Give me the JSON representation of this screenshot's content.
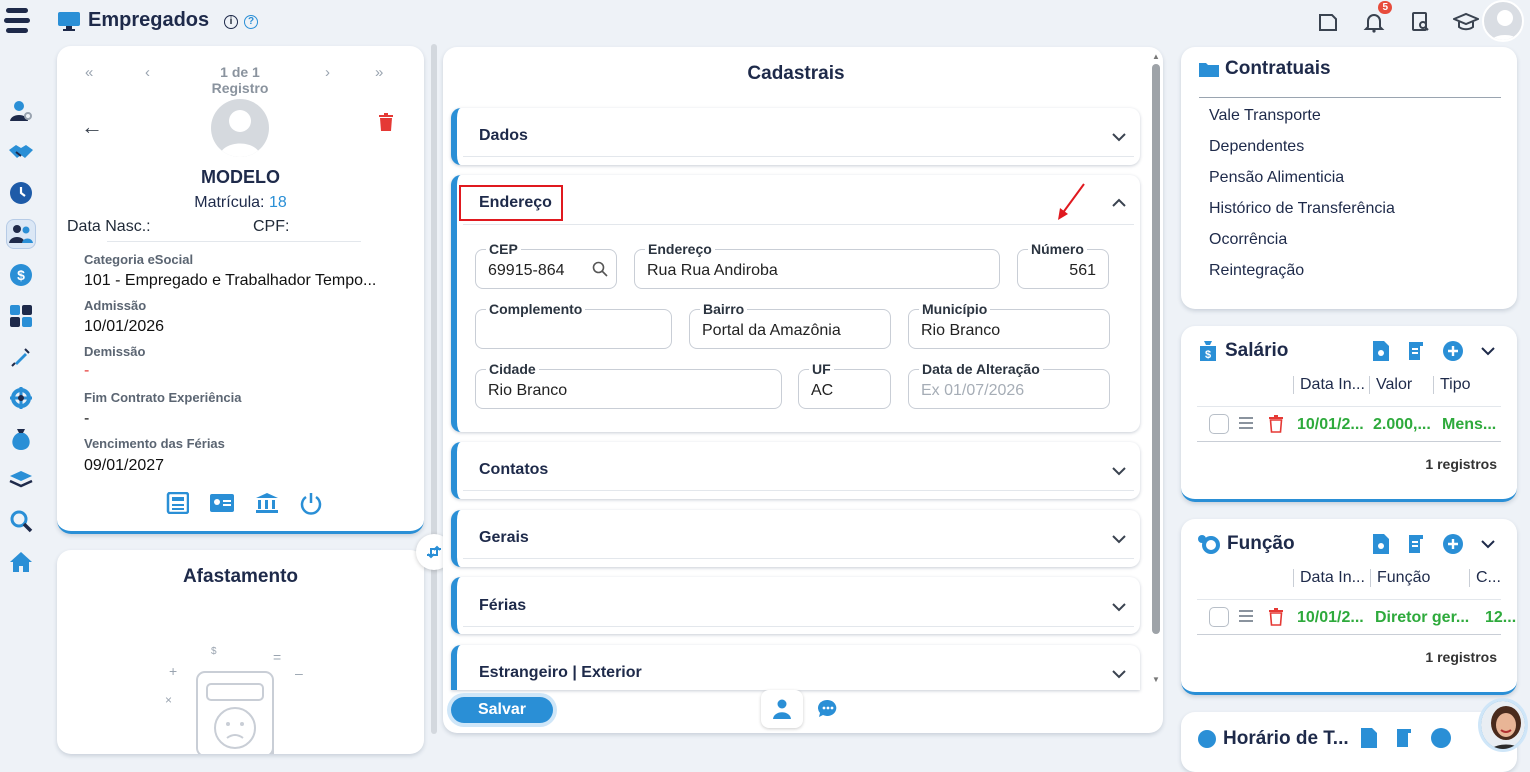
{
  "header": {
    "title": "Empregados",
    "notification_count": "5"
  },
  "nav_icons": [
    "user-gear-icon",
    "handshake-icon",
    "clock-icon",
    "users-icon",
    "dollar-icon",
    "calculator-icon",
    "syringe-icon",
    "settings-wheel-icon",
    "money-bag-icon",
    "layers-icon",
    "search-icon",
    "home-icon"
  ],
  "employee": {
    "pager_text": "1 de 1 Registro",
    "name": "MODELO",
    "matricula_label": "Matrícula:",
    "matricula_value": "18",
    "data_nasc_label": "Data Nasc.:",
    "cpf_label": "CPF:",
    "categoria_label": "Categoria eSocial",
    "categoria_value": "101 - Empregado e Trabalhador Tempo...",
    "admissao_label": "Admissão",
    "admissao_value": "10/01/2026",
    "demissao_label": "Demissão",
    "demissao_value": "-",
    "fim_contrato_label": "Fim Contrato Experiência",
    "fim_contrato_value": "-",
    "vencimento_label": "Vencimento das Férias",
    "vencimento_value": "09/01/2027"
  },
  "afastamento": {
    "title": "Afastamento"
  },
  "cadastrais": {
    "title": "Cadastrais",
    "sections": {
      "dados": "Dados",
      "endereco": "Endereço",
      "contatos": "Contatos",
      "gerais": "Gerais",
      "ferias": "Férias",
      "estrangeiro": "Estrangeiro | Exterior"
    },
    "fields": {
      "cep": {
        "label": "CEP",
        "value": "69915-864"
      },
      "endereco": {
        "label": "Endereço",
        "value": "Rua Rua Andiroba"
      },
      "numero": {
        "label": "Número",
        "value": "561"
      },
      "complemento": {
        "label": "Complemento",
        "value": ""
      },
      "bairro": {
        "label": "Bairro",
        "value": "Portal da Amazônia"
      },
      "municipio": {
        "label": "Município",
        "value": "Rio Branco"
      },
      "cidade": {
        "label": "Cidade",
        "value": "Rio Branco"
      },
      "uf": {
        "label": "UF",
        "value": "AC"
      },
      "data_alteracao": {
        "label": "Data de Alteração",
        "placeholder": "Ex 01/07/2026"
      }
    },
    "save_label": "Salvar"
  },
  "contratuais": {
    "title": "Contratuais",
    "items": [
      "Vale Transporte",
      "Dependentes",
      "Pensão Alimenticia",
      "Histórico de Transferência",
      "Ocorrência",
      "Reintegração"
    ]
  },
  "salario": {
    "title": "Salário",
    "columns": [
      "Data In...",
      "Valor",
      "Tipo"
    ],
    "row": [
      "10/01/2...",
      "2.000,...",
      "Mens..."
    ],
    "count": "1 registros"
  },
  "funcao": {
    "title": "Função",
    "columns": [
      "Data In...",
      "Função",
      "C..."
    ],
    "row": [
      "10/01/2...",
      "Diretor ger...",
      "12..."
    ],
    "count": "1 registros"
  },
  "horario": {
    "title": "Horário de T..."
  },
  "colors": {
    "accent": "#2a8fd6",
    "navy": "#1e2a4a",
    "green": "#2eaa3c",
    "red": "#e0191f"
  }
}
